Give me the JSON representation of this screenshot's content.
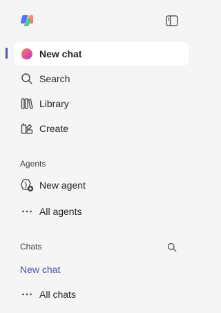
{
  "sidebar": {
    "primary_items": [
      {
        "label": "New chat",
        "icon": "copilot-chat-icon",
        "active": true
      },
      {
        "label": "Search",
        "icon": "search-icon"
      },
      {
        "label": "Library",
        "icon": "library-icon"
      },
      {
        "label": "Create",
        "icon": "create-icon"
      }
    ],
    "agents": {
      "heading": "Agents",
      "items": [
        {
          "label": "New agent",
          "icon": "new-agent-icon"
        },
        {
          "label": "All agents",
          "icon": "more-icon"
        }
      ]
    },
    "chats": {
      "heading": "Chats",
      "items": [
        {
          "label": "New chat"
        },
        {
          "label": "All chats",
          "icon": "more-icon"
        }
      ]
    }
  },
  "colors": {
    "background": "#f5f5f5",
    "active_item_bg": "#ffffff",
    "accent": "#4f52b2",
    "text": "#242424"
  }
}
